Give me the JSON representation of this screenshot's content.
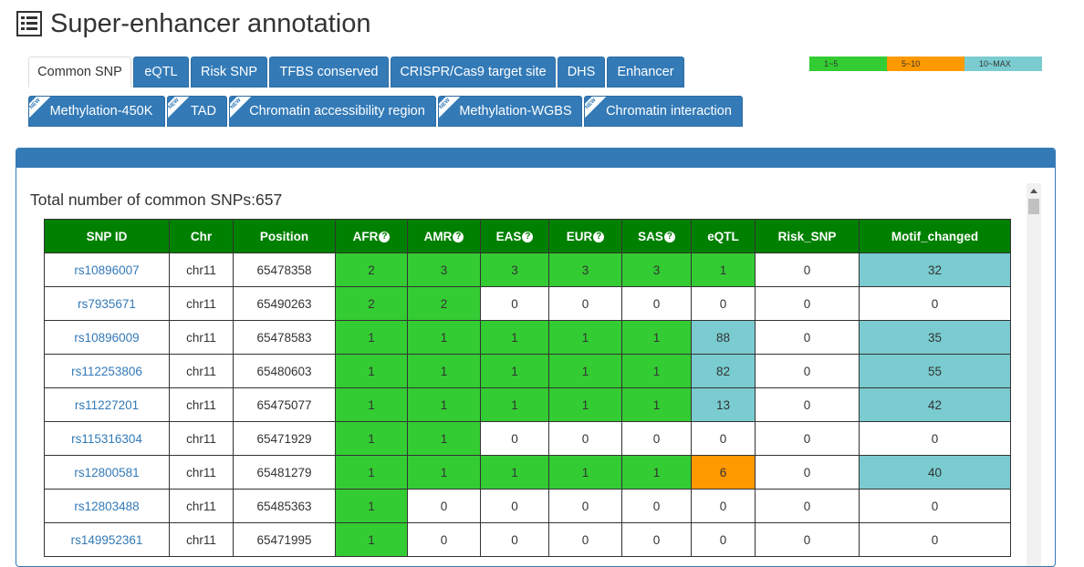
{
  "page": {
    "title": "Super-enhancer annotation",
    "title_icon": "list-icon"
  },
  "tabs_row1": [
    {
      "label": "Common SNP",
      "active": true
    },
    {
      "label": "eQTL"
    },
    {
      "label": "Risk SNP"
    },
    {
      "label": "TFBS conserved"
    },
    {
      "label": "CRISPR/Cas9 target site"
    },
    {
      "label": "DHS"
    },
    {
      "label": "Enhancer"
    }
  ],
  "tabs_row2": [
    {
      "label": "Methylation-450K",
      "badge": "NEW"
    },
    {
      "label": "TAD",
      "badge": "NEW"
    },
    {
      "label": "Chromatin accessibility region",
      "badge": "NEW"
    },
    {
      "label": "Methylation-WGBS",
      "badge": "NEW"
    },
    {
      "label": "Chromatin interaction",
      "badge": "NEW"
    }
  ],
  "legend": [
    {
      "label": "1~5",
      "color": "#33cc33"
    },
    {
      "label": "5~10",
      "color": "#ff9900"
    },
    {
      "label": "10~MAX",
      "color": "#7accd0"
    }
  ],
  "panel": {
    "summary": "Total number of common SNPs:657"
  },
  "table": {
    "columns": [
      "SNP ID",
      "Chr",
      "Position",
      "AFR",
      "AMR",
      "EAS",
      "EUR",
      "SAS",
      "eQTL",
      "Risk_SNP",
      "Motif_changed"
    ],
    "help_columns": [
      "AFR",
      "AMR",
      "EAS",
      "EUR",
      "SAS"
    ],
    "rows": [
      [
        "rs10896007",
        "chr11",
        "65478358",
        "2",
        "3",
        "3",
        "3",
        "3",
        "1",
        "0",
        "32"
      ],
      [
        "rs7935671",
        "chr11",
        "65490263",
        "2",
        "2",
        "0",
        "0",
        "0",
        "0",
        "0",
        "0"
      ],
      [
        "rs10896009",
        "chr11",
        "65478583",
        "1",
        "1",
        "1",
        "1",
        "1",
        "88",
        "0",
        "35"
      ],
      [
        "rs112253806",
        "chr11",
        "65480603",
        "1",
        "1",
        "1",
        "1",
        "1",
        "82",
        "0",
        "55"
      ],
      [
        "rs11227201",
        "chr11",
        "65475077",
        "1",
        "1",
        "1",
        "1",
        "1",
        "13",
        "0",
        "42"
      ],
      [
        "rs115316304",
        "chr11",
        "65471929",
        "1",
        "1",
        "0",
        "0",
        "0",
        "0",
        "0",
        "0"
      ],
      [
        "rs12800581",
        "chr11",
        "65481279",
        "1",
        "1",
        "1",
        "1",
        "1",
        "6",
        "0",
        "40"
      ],
      [
        "rs12803488",
        "chr11",
        "65485363",
        "1",
        "0",
        "0",
        "0",
        "0",
        "0",
        "0",
        "0"
      ],
      [
        "rs149952361",
        "chr11",
        "65471995",
        "1",
        "0",
        "0",
        "0",
        "0",
        "0",
        "0",
        "0"
      ]
    ]
  }
}
